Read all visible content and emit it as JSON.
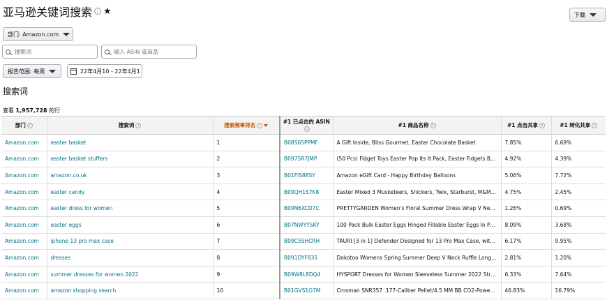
{
  "header": {
    "title": "亚马逊关键词搜索",
    "info_glyph": "i",
    "star": "★",
    "download_label": "下载"
  },
  "filters": {
    "department_label": "部门: Amazon.com",
    "search_placeholder": "搜索词",
    "asin_placeholder": "输入 ASIN 或商品",
    "report_range_label": "报告范围: 每周",
    "date_range_value": "22年4月10 - 22年4月16"
  },
  "results": {
    "section_title": "搜索词",
    "count_prefix": "查看",
    "count_value": "1,957,728",
    "count_suffix": "的行"
  },
  "table": {
    "headers": {
      "department": "部门",
      "search_term": "搜索词",
      "frequency_rank": "搜索频率排名",
      "asin": "#1 已点击的 ASIN",
      "product": "#1 商品名称",
      "click_share": "#1 点击共享",
      "conversion_share": "#1 转化共享"
    },
    "rows": [
      {
        "dept": "Amazon.com",
        "term": "easter basket",
        "rank": "1",
        "asin": "B08S65PPMF",
        "product": "A Gift Inside, Bliss Gourmet, Easter Chocolate Basket",
        "click": "7.85%",
        "conv": "6.69%"
      },
      {
        "dept": "Amazon.com",
        "term": "easter basket stuffers",
        "rank": "2",
        "asin": "B0975R7JMP",
        "product": "(50 Pcs) Fidget Toys Easter Pop Its It Pack, Easter Fidgets Basket Stuffers",
        "click": "4.92%",
        "conv": "4.39%"
      },
      {
        "dept": "Amazon.com",
        "term": "amazon.co.uk",
        "rank": "3",
        "asin": "B01FIS88SY",
        "product": "Amazon eGift Card - Happy Birthday Balloons",
        "click": "5.06%",
        "conv": "7.72%"
      },
      {
        "dept": "Amazon.com",
        "term": "easter candy",
        "rank": "4",
        "asin": "B09QH1S7K8",
        "product": "Easter Mixed 3 Musketeers, Snickers, Twix, Starburst, M&M 100 Pieces",
        "click": "4.75%",
        "conv": "2.45%"
      },
      {
        "dept": "Amazon.com",
        "term": "easter dress for women",
        "rank": "5",
        "asin": "B09N6XCD7C",
        "product": "PRETTYGARDEN Women's Floral Summer Dress Wrap V Neck Short Sleeve",
        "click": "1.26%",
        "conv": "0.69%"
      },
      {
        "dept": "Amazon.com",
        "term": "easter eggs",
        "rank": "6",
        "asin": "B07NWYYSKY",
        "product": "100 Pack Bulk Easter Eggs Hinged Fillable Easter Eggs In Polly Bag",
        "click": "8.09%",
        "conv": "3.68%"
      },
      {
        "dept": "Amazon.com",
        "term": "iphone 13 pro max case",
        "rank": "7",
        "asin": "B09C5SHCRH",
        "product": "TAURI [3 in 1] Defender Designed for 13 Pro Max Case, with 2 Pack Screen",
        "click": "6.17%",
        "conv": "9.95%"
      },
      {
        "dept": "Amazon.com",
        "term": "dresses",
        "rank": "8",
        "asin": "B091DYF835",
        "product": "Dokotoo Womens Spring Summer Deep V Neck Ruffle Long Sleeve Dress",
        "click": "2.81%",
        "conv": "1.20%"
      },
      {
        "dept": "Amazon.com",
        "term": "summer dresses for women 2022",
        "rank": "9",
        "asin": "B09W8L8DQ4",
        "product": "HYSPORT Dresses for Women Sleeveless Summer 2022 Striped Sundress",
        "click": "6.33%",
        "conv": "7.64%"
      },
      {
        "dept": "Amazon.com",
        "term": "amazon shopping search",
        "rank": "10",
        "asin": "B01GVS1O7M",
        "product": "Crosman SNR357 .177-Caliber Pellet/4.5 MM BB CO2-Powered Air Pistol",
        "click": "46.83%",
        "conv": "16.79%"
      }
    ]
  },
  "colors": {
    "link": "#007185",
    "sorted_header": "#c45500",
    "header_bg": "#f3f3f3"
  }
}
